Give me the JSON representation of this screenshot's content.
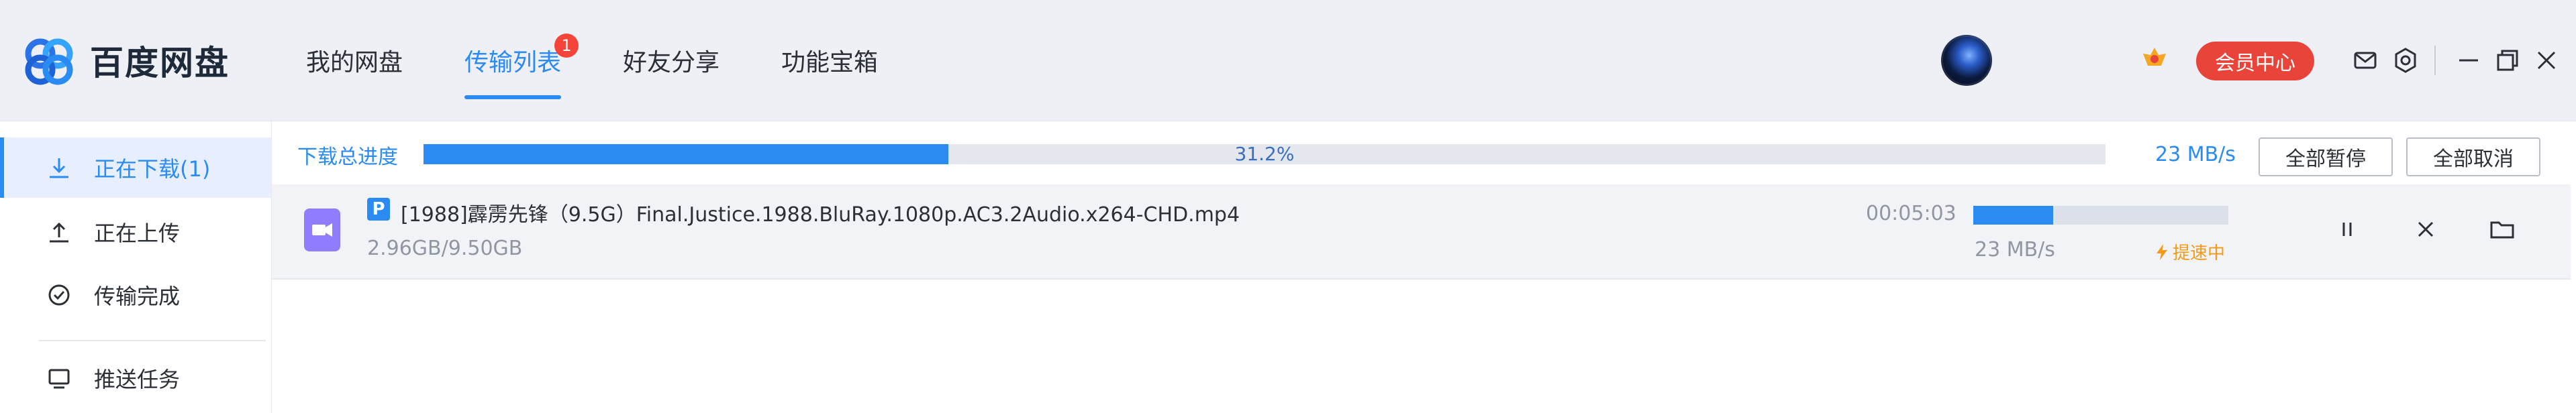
{
  "app": {
    "name": "百度网盘"
  },
  "nav": [
    {
      "label": "我的网盘"
    },
    {
      "label": "传输列表",
      "badge": "1"
    },
    {
      "label": "好友分享"
    },
    {
      "label": "功能宝箱"
    }
  ],
  "header": {
    "vip_label": "会员中心"
  },
  "sidebar": {
    "items": [
      {
        "label": "正在下载(1)",
        "icon": "download-icon"
      },
      {
        "label": "正在上传",
        "icon": "upload-icon"
      },
      {
        "label": "传输完成",
        "icon": "check-circle-icon"
      },
      {
        "label": "推送任务",
        "icon": "monitor-icon"
      }
    ]
  },
  "summary": {
    "label": "下载总进度",
    "progress_text": "31.2%",
    "progress": 0.312,
    "speed": "23 MB/s",
    "pause_all": "全部暂停",
    "cancel_all": "全部取消"
  },
  "downloads": [
    {
      "badge": "P",
      "name": "[1988]霹雳先锋（9.5G）Final.Justice.1988.BluRay.1080p.AC3.2Audio.x264-CHD.mp4",
      "size": "2.96GB/9.50GB",
      "time_left": "00:05:03",
      "progress": 0.312,
      "speed": "23 MB/s",
      "status": "提速中"
    }
  ],
  "colors": {
    "accent": "#2a8bf2",
    "badge": "#f5453a",
    "vip": "#e8443a",
    "accel": "#f29a1a"
  }
}
